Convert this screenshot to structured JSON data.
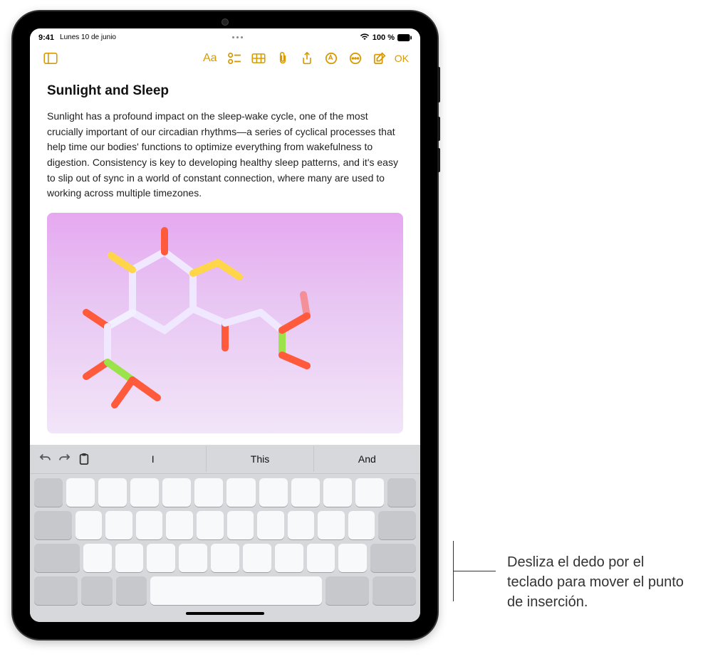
{
  "status": {
    "time": "9:41",
    "date": "Lunes 10 de junio",
    "battery_pct": "100 %",
    "wifi_icon": "wifi",
    "battery_icon": "battery-full"
  },
  "toolbar": {
    "sidebar_icon": "sidebar",
    "format_icon": "Aa",
    "list_icon": "checklist",
    "table_icon": "table",
    "attach_icon": "paperclip",
    "share_icon": "share",
    "markup_icon": "markup",
    "more_icon": "more",
    "compose_icon": "compose",
    "done_label": "OK"
  },
  "note": {
    "title": "Sunlight and Sleep",
    "body": "Sunlight has a profound impact on the sleep-wake cycle, one of the most crucially important of our circadian rhythms—a series of cyclical processes that help time our bodies' functions to optimize everything from wakefulness to digestion. Consistency is key to developing healthy sleep patterns, and it's easy to slip out of sync in a world of constant connection, where many are used to working across multiple timezones."
  },
  "suggestions": {
    "undo_icon": "undo",
    "redo_icon": "redo",
    "clipboard_icon": "clipboard",
    "words": [
      "I",
      "This",
      "And"
    ]
  },
  "callout": {
    "text": "Desliza el dedo por el teclado para mover el punto de inserción."
  }
}
